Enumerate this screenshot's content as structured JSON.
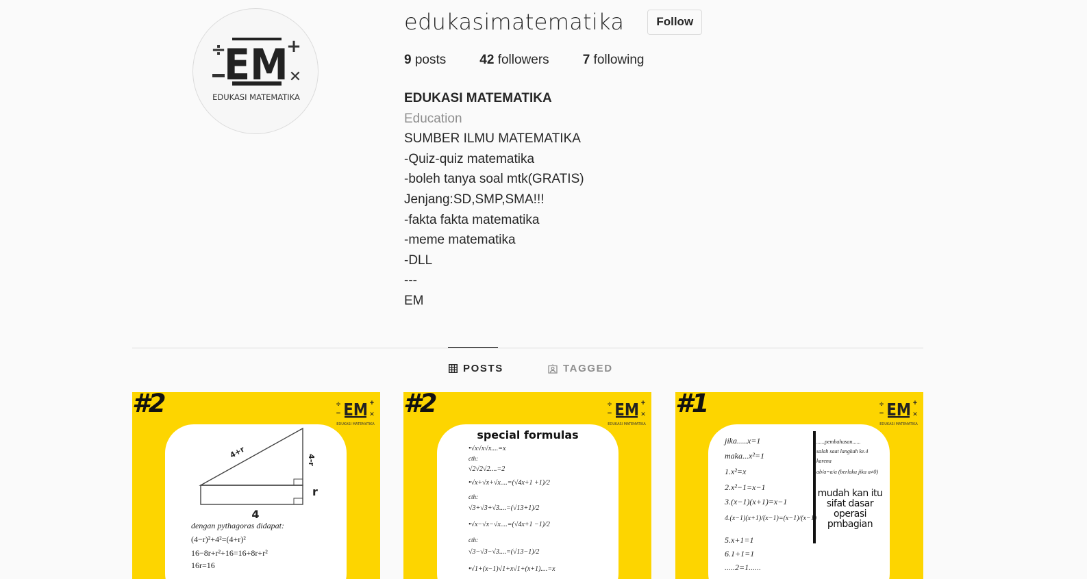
{
  "profile": {
    "username": "edukasimatematika",
    "follow_label": "Follow",
    "avatar": {
      "logo_text": "EM",
      "logo_caption": "EDUKASI MATEMATIKA",
      "symbols": [
        "÷",
        "+",
        "−",
        "×"
      ]
    }
  },
  "stats": {
    "posts_count": "9",
    "posts_label": "posts",
    "followers_count": "42",
    "followers_label": "followers",
    "following_count": "7",
    "following_label": "following"
  },
  "bio": {
    "name": "EDUKASI MATEMATIKA",
    "category": "Education",
    "lines": [
      "SUMBER ILMU MATEMATIKA",
      "-Quiz-quiz matematika",
      "-boleh tanya soal mtk(GRATIS)",
      "Jenjang:SD,SMP,SMA!!!",
      "-fakta fakta matematika",
      "-meme matematika",
      "-DLL",
      "---",
      "EM"
    ]
  },
  "tabs": {
    "posts": "POSTS",
    "tagged": "TAGGED"
  },
  "posts": [
    {
      "number": "#2",
      "logo_text": "EM",
      "logo_caption": "EDUKASI MATEMATIKA",
      "labels": {
        "hyp": "4+r",
        "side": "4-r",
        "right": "r",
        "base": "4"
      },
      "lines": [
        "dengan pythagoras didapat:",
        "(4−r)²+4²=(4+r)²",
        "16−8r+r²+16=16+8r+r²",
        "16r=16"
      ]
    },
    {
      "number": "#2",
      "logo_text": "EM",
      "logo_caption": "EDUKASI MATEMATIKA",
      "title": "special formulas",
      "lines": [
        "•√x√x√x....=x",
        "cth:",
        "√2√2√2....=2",
        "•√x+√x+√x....=(√4x+1 +1)/2",
        "cth:",
        "√3+√3+√3....=(√13+1)/2",
        "•√x−√x−√x....=(√4x+1 −1)/2",
        "cth:",
        "√3−√3−√3....=(√13−1)/2",
        "•√1+(x−1)√1+x√1+(x+1)....=x"
      ]
    },
    {
      "number": "#1",
      "logo_text": "EM",
      "logo_caption": "EDUKASI MATEMATIKA",
      "left_lines": [
        "jika.....x=1",
        "maka...x²=1",
        "1.x²=x",
        "2.x²−1=x−1",
        "3.(x−1)(x+1)=x−1",
        "4.(x−1)(x+1)/(x−1)=(x−1)/(x−1)",
        "5.x+1=1",
        "6.1+1=1",
        ".....2=1......"
      ],
      "right_small": [
        "......pembahasan......",
        "salah saat langkah ke.4",
        "karena",
        "ab/a=a/a (berlaku jika a≠0)"
      ],
      "right_note": "mudah kan itu sifat dasar operasi pmbagian"
    }
  ]
}
